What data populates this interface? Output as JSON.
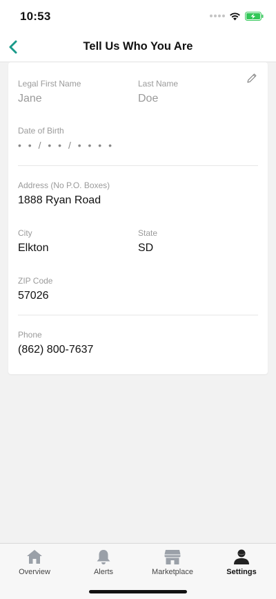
{
  "status_bar": {
    "time": "10:53"
  },
  "header": {
    "title": "Tell Us Who You Are"
  },
  "form": {
    "first_name": {
      "label": "Legal First Name",
      "value": "Jane"
    },
    "last_name": {
      "label": "Last Name",
      "value": "Doe"
    },
    "dob": {
      "label": "Date of Birth",
      "value": "• • / • • / • • • •"
    },
    "address": {
      "label": "Address (No P.O. Boxes)",
      "value": "1888 Ryan Road"
    },
    "city": {
      "label": "City",
      "value": "Elkton"
    },
    "state": {
      "label": "State",
      "value": "SD"
    },
    "zip": {
      "label": "ZIP Code",
      "value": "57026"
    },
    "phone": {
      "label": "Phone",
      "value": "(862) 800-7637"
    }
  },
  "tabs": [
    {
      "label": "Overview",
      "icon": "home-icon"
    },
    {
      "label": "Alerts",
      "icon": "bell-icon"
    },
    {
      "label": "Marketplace",
      "icon": "store-icon"
    },
    {
      "label": "Settings",
      "icon": "user-icon",
      "active": true
    }
  ],
  "colors": {
    "accent": "#1a9a8a",
    "battery": "#34c759",
    "tab_icon_inactive": "#9aa0a8"
  }
}
